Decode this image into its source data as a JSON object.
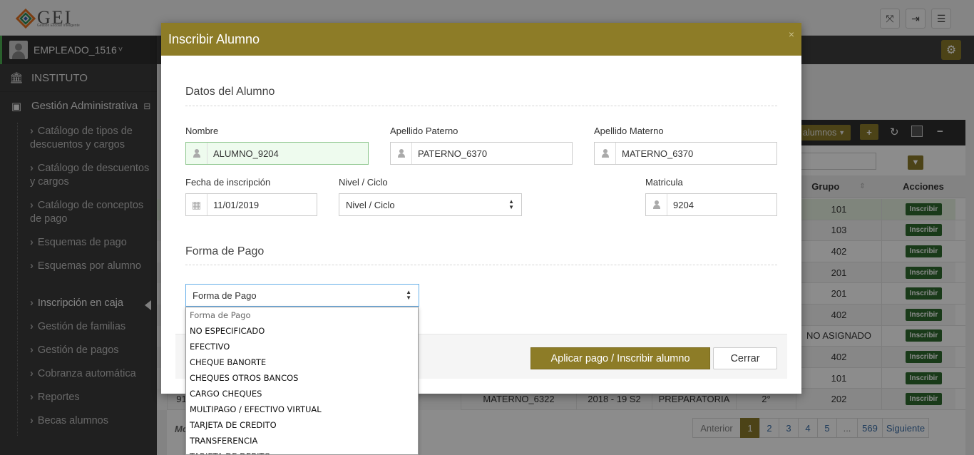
{
  "header": {
    "logo_text": "GEI",
    "logo_subtitle": "Gestión Escolar Inteligente",
    "buttons": [
      "expand-icon",
      "logout-icon",
      "menu-icon"
    ]
  },
  "sidebar": {
    "user": "EMPLEADO_1516",
    "user_caret": "˅",
    "sections": [
      {
        "label": "INSTITUTO",
        "icon": "bank-icon"
      },
      {
        "label": "Gestión Administrativa",
        "icon": "money-icon",
        "toggle": "⊟"
      }
    ],
    "items": [
      {
        "label": "Catálogo de tipos de descuentos y cargos"
      },
      {
        "label": "Catálogo de descuentos y cargos"
      },
      {
        "label": "Catálogo de conceptos de pago"
      },
      {
        "label": "Esquemas de pago"
      },
      {
        "label": "Esquemas por alumno"
      },
      {
        "label": "Inscripción en caja",
        "active": true
      },
      {
        "label": "Gestión de familias"
      },
      {
        "label": "Gestión de pagos"
      },
      {
        "label": "Cobranza automática"
      },
      {
        "label": "Reportes"
      },
      {
        "label": "Becas alumnos"
      }
    ]
  },
  "background_table": {
    "alumnos_button": "alumnos",
    "columns": {
      "grupo": "Grupo",
      "acciones": "Acciones"
    },
    "rows": [
      {
        "grupo": "101",
        "action": "Inscribir"
      },
      {
        "grupo": "103",
        "action": "Inscribir"
      },
      {
        "grupo": "402",
        "action": "Inscribir"
      },
      {
        "grupo": "201",
        "action": "Inscribir"
      },
      {
        "grupo": "201",
        "action": "Inscribir"
      },
      {
        "grupo": "402",
        "action": "Inscribir"
      },
      {
        "grupo": "NO ASIGNADO",
        "action": "Inscribir"
      },
      {
        "grupo": "402",
        "action": "Inscribir"
      },
      {
        "grupo": "101",
        "action": "Inscribir"
      },
      {
        "grupo": "202",
        "action": "Inscribir"
      }
    ],
    "last_row": {
      "col1": "91",
      "materno": "MATERNO_6322",
      "ciclo": "2018 - 19 S2",
      "nivel": "PREPARATORIA",
      "grado": "2°"
    },
    "footer_label": "Mo",
    "pager": [
      "Anterior",
      "1",
      "2",
      "3",
      "4",
      "5",
      "...",
      "569",
      "Siguiente"
    ]
  },
  "modal": {
    "title": "Inscribir Alumno",
    "close": "×",
    "section1": "Datos del Alumno",
    "nombre": {
      "label": "Nombre",
      "value": "ALUMNO_9204"
    },
    "paterno": {
      "label": "Apellido Paterno",
      "value": "PATERNO_6370"
    },
    "materno": {
      "label": "Apellido Materno",
      "value": "MATERNO_6370"
    },
    "fecha": {
      "label": "Fecha de inscripción",
      "value": "11/01/2019"
    },
    "nivel": {
      "label": "Nivel / Ciclo",
      "value": "Nivel / Ciclo"
    },
    "matricula": {
      "label": "Matricula",
      "value": "9204"
    },
    "section2": "Forma de Pago",
    "forma_pago": {
      "value": "Forma de Pago"
    },
    "apply_button": "Aplicar pago / Inscribir alumno",
    "close_button": "Cerrar"
  },
  "dropdown_options": [
    "Forma de Pago",
    "NO ESPECIFICADO",
    "EFECTIVO",
    "CHEQUE BANORTE",
    "CHEQUES OTROS BANCOS",
    "CARGO CHEQUES",
    "MULTIPAGO / EFECTIVO VIRTUAL",
    "TARJETA DE CREDITO",
    "TRANSFERENCIA",
    "TARJETA DE DEBITO"
  ],
  "colors": {
    "accent": "#8d7c27",
    "success": "#2e6b2e",
    "sidebar": "#3b3b3b"
  }
}
